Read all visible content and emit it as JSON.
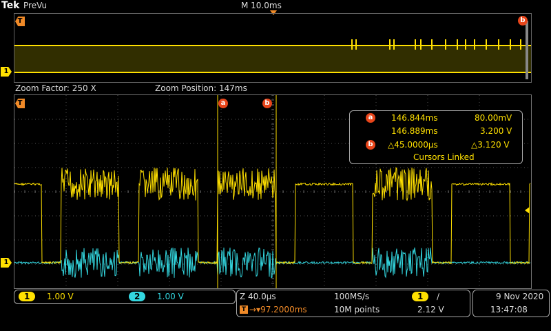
{
  "header": {
    "brand": "Tek",
    "mode": "PreVu",
    "timebase": "M 10.0ms"
  },
  "zoom_info": {
    "factor": "Zoom Factor: 250 X",
    "position": "Zoom Position: 147ms"
  },
  "markers": {
    "trigger": "T",
    "ch1": "1",
    "cursor_a": "a",
    "cursor_b": "b"
  },
  "cursor_readout": {
    "a_time": "146.844ms",
    "a_value": "80.00mV",
    "b_time": "146.889ms",
    "b_value": "3.200 V",
    "delta_time": "△45.0000µs",
    "delta_value": "△3.120 V",
    "linked": "Cursors Linked"
  },
  "channels": [
    {
      "id": "1",
      "scale": "1.00 V",
      "color": "#ffe000"
    },
    {
      "id": "2",
      "scale": "1.00 V",
      "color": "#33d7e0"
    }
  ],
  "acquisition": {
    "zoom_scale": "Z 40.0µs",
    "trigger_position": "→▾97.2000ms",
    "sample_rate": "100MS/s",
    "record_length": "10M points",
    "trigger_channel": "1",
    "trigger_slope": "∕",
    "trigger_level": "2.12 V"
  },
  "datetime": {
    "date": "9 Nov 2020",
    "time": "13:47:08"
  },
  "colors": {
    "ch1": "#ffe000",
    "ch2": "#33d7e0",
    "trigger": "#f08a28",
    "cursor_badge": "#e8451a",
    "graticule": "#555555"
  }
}
